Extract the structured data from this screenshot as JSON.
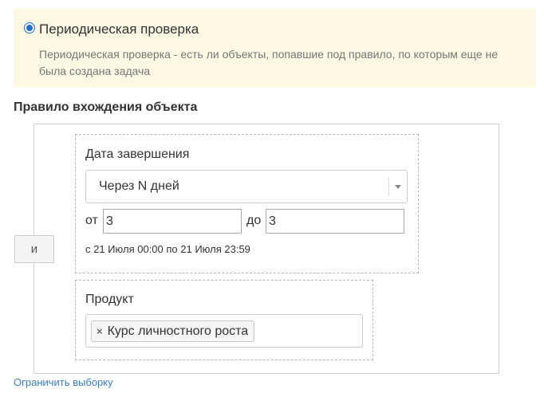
{
  "check": {
    "radio_label": "Периодическая проверка",
    "description": "Периодическая проверка - есть ли объекты, попавшие под правило, по которым еще не была создана задача"
  },
  "rule": {
    "title": "Правило вхождения объекта",
    "operator_label": "и",
    "date_condition": {
      "label": "Дата завершения",
      "mode_value": "Через N дней",
      "from_label": "от",
      "from_value": "3",
      "to_label": "до",
      "to_value": "3",
      "range_text": "с 21 Июля 00:00 по 21 Июля 23:59"
    },
    "product_condition": {
      "label": "Продукт",
      "selected_tags": [
        "Курс личностного роста"
      ],
      "tag_remove_glyph": "×"
    },
    "limit_link": "Ограничить выборку"
  },
  "colors": {
    "banner_bg": "#fcf8e3",
    "radio_accent": "#1f6fd1",
    "link": "#3a7dbf"
  }
}
